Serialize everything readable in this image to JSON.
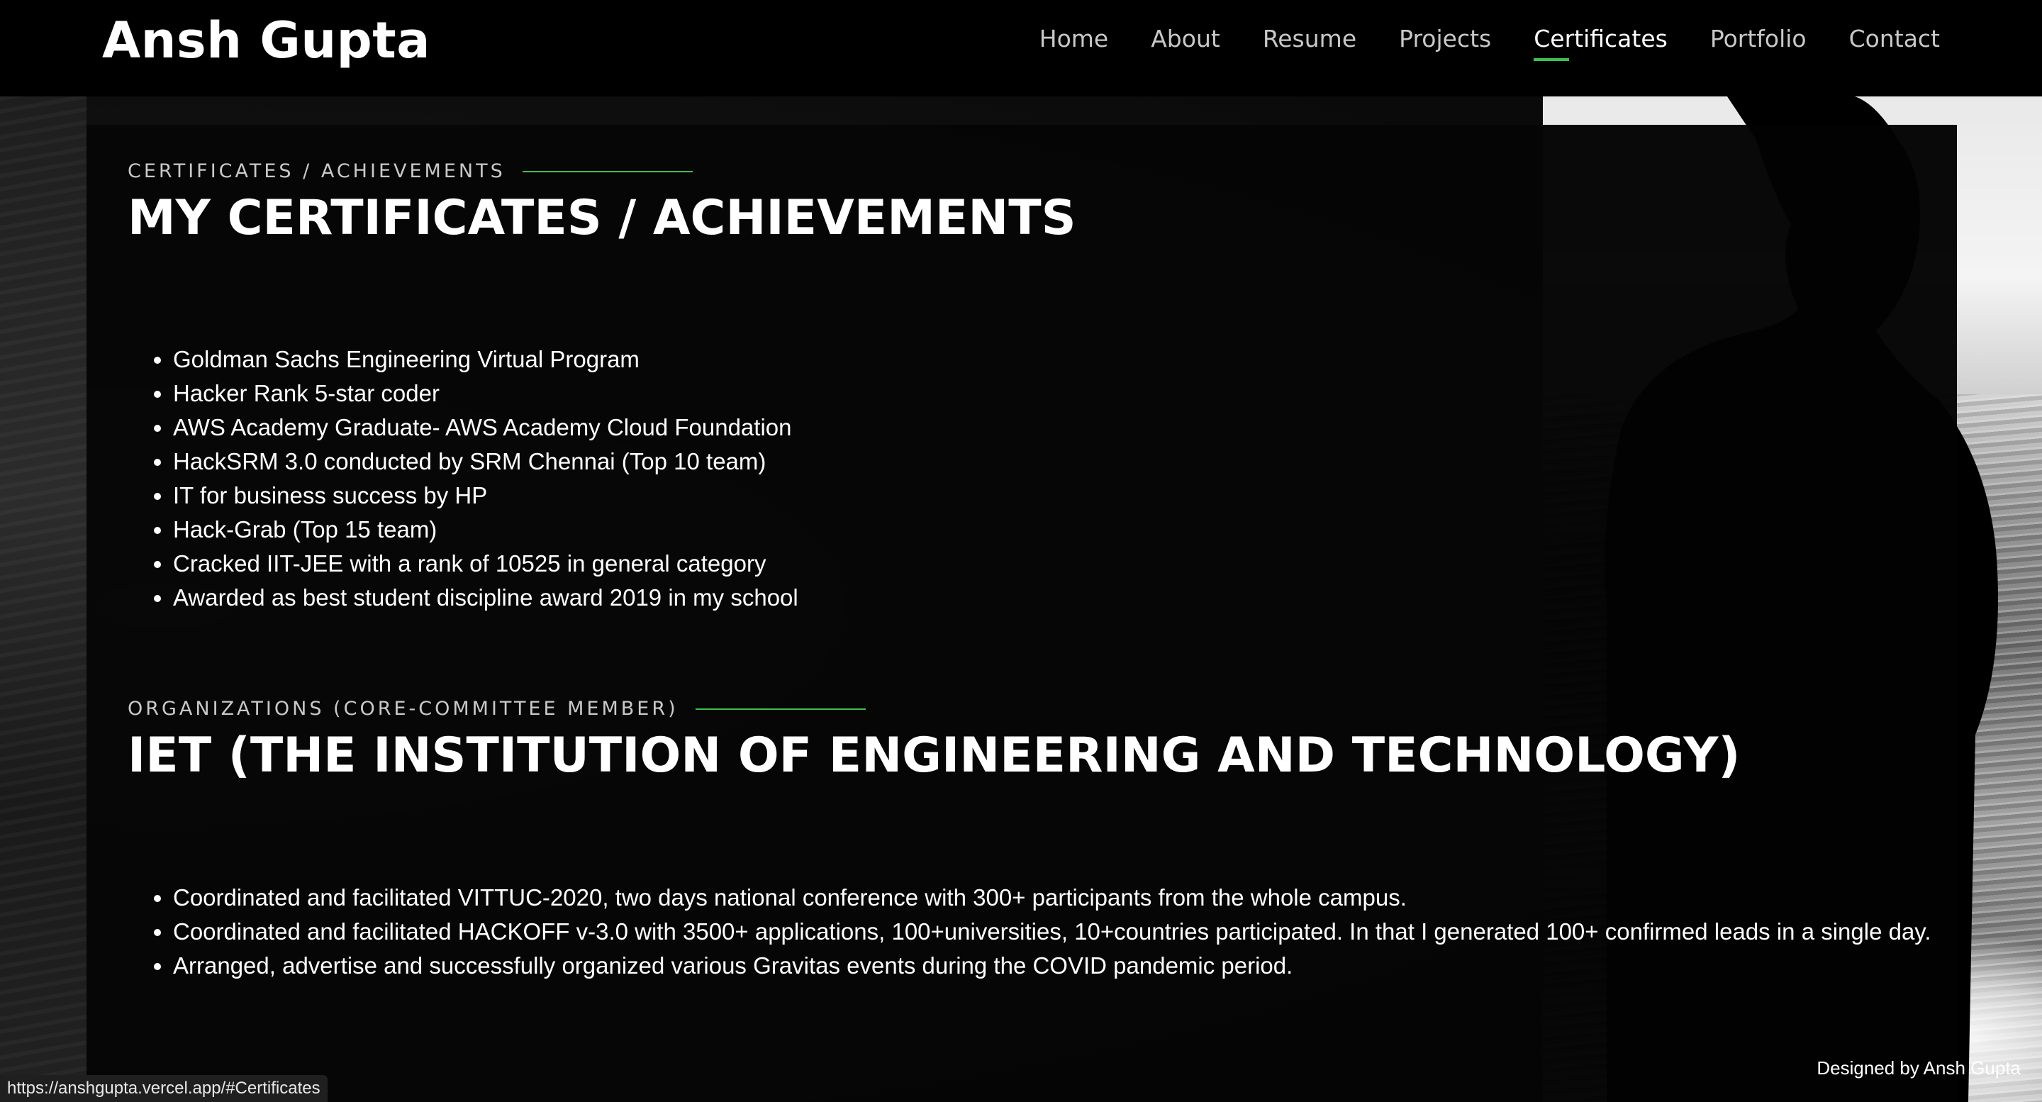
{
  "brand": {
    "name": "Ansh Gupta"
  },
  "nav": {
    "items": [
      {
        "label": "Home"
      },
      {
        "label": "About"
      },
      {
        "label": "Resume"
      },
      {
        "label": "Projects"
      },
      {
        "label": "Certificates"
      },
      {
        "label": "Portfolio"
      },
      {
        "label": "Contact"
      }
    ],
    "active": "Certificates",
    "accent_color": "#3fbf4f"
  },
  "certificates": {
    "kicker": "CERTIFICATES / ACHIEVEMENTS",
    "title": "MY CERTIFICATES / ACHIEVEMENTS",
    "items": [
      "Goldman Sachs Engineering Virtual Program",
      "Hacker Rank 5-star coder",
      "AWS Academy Graduate- AWS Academy Cloud Foundation",
      "HackSRM 3.0 conducted by SRM Chennai (Top 10 team)",
      "IT for business success by HP",
      "Hack-Grab (Top 15 team)",
      "Cracked IIT-JEE with a rank of 10525 in general category",
      "Awarded as best student discipline award 2019 in my school"
    ]
  },
  "organizations": {
    "kicker": "ORGANIZATIONS (CORE-COMMITTEE MEMBER)",
    "title": "IET (THE INSTITUTION OF ENGINEERING AND TECHNOLOGY)",
    "items": [
      "Coordinated and facilitated VITTUC-2020, two days national conference with 300+ participants from the whole campus.",
      "Coordinated and facilitated HACKOFF v-3.0 with 3500+ applications, 100+universities, 10+countries participated. In that I generated 100+ confirmed leads in a single day.",
      "Arranged, advertise and successfully organized various Gravitas events during the COVID pandemic period."
    ]
  },
  "footer": {
    "credit": "Designed by Ansh Gupta"
  },
  "status_bar": {
    "url": "https://anshgupta.vercel.app/#Certificates"
  }
}
